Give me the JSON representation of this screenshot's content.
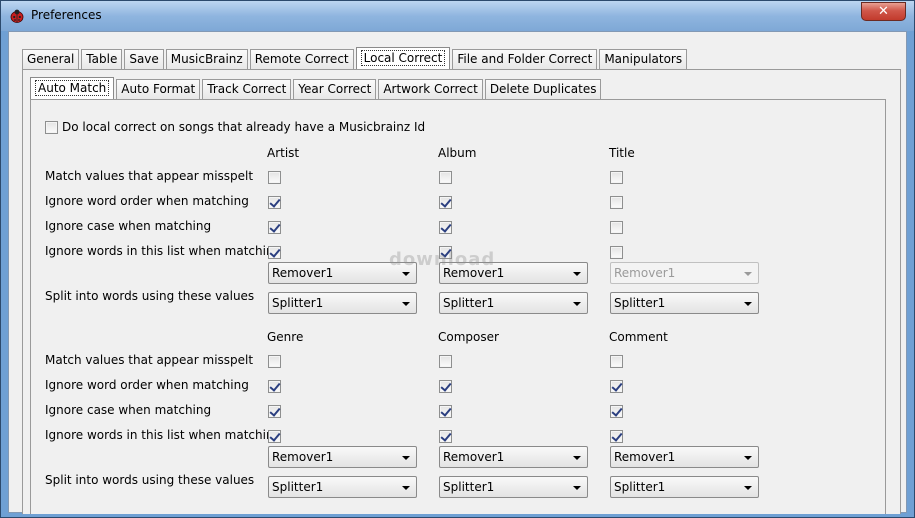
{
  "window": {
    "title": "Preferences",
    "close_glyph": "✕"
  },
  "main_tabs": [
    "General",
    "Table",
    "Save",
    "MusicBrainz",
    "Remote Correct",
    "Local Correct",
    "File and Folder Correct",
    "Manipulators"
  ],
  "sub_tabs": [
    "Auto Match",
    "Auto Format",
    "Track Correct",
    "Year Correct",
    "Artwork Correct",
    "Delete Duplicates"
  ],
  "musicbrainz_option": {
    "label": "Do local correct on songs that already have a Musicbrainz Id",
    "checked": false
  },
  "rows": {
    "misspelt": "Match values that appear misspelt",
    "word_order": "Ignore word order when matching",
    "ignore_case": "Ignore case when matching",
    "ignore_words": "Ignore words in this list when matching",
    "split": "Split into words using these values"
  },
  "group1": {
    "headers": [
      "Artist",
      "Album",
      "Title"
    ],
    "checks": {
      "misspelt": [
        false,
        false,
        false
      ],
      "word_order": [
        true,
        true,
        false
      ],
      "ignore_case": [
        true,
        true,
        false
      ],
      "ignore_words": [
        true,
        true,
        false
      ]
    },
    "remover": [
      "Remover1",
      "Remover1",
      "Remover1"
    ],
    "remover_disabled": [
      false,
      false,
      true
    ],
    "splitter": [
      "Splitter1",
      "Splitter1",
      "Splitter1"
    ]
  },
  "group2": {
    "headers": [
      "Genre",
      "Composer",
      "Comment"
    ],
    "checks": {
      "misspelt": [
        false,
        false,
        false
      ],
      "word_order": [
        true,
        true,
        true
      ],
      "ignore_case": [
        true,
        true,
        true
      ],
      "ignore_words": [
        true,
        true,
        true
      ]
    },
    "remover": [
      "Remover1",
      "Remover1",
      "Remover1"
    ],
    "remover_disabled": [
      false,
      false,
      false
    ],
    "splitter": [
      "Splitter1",
      "Splitter1",
      "Splitter1"
    ]
  },
  "watermark": "download"
}
